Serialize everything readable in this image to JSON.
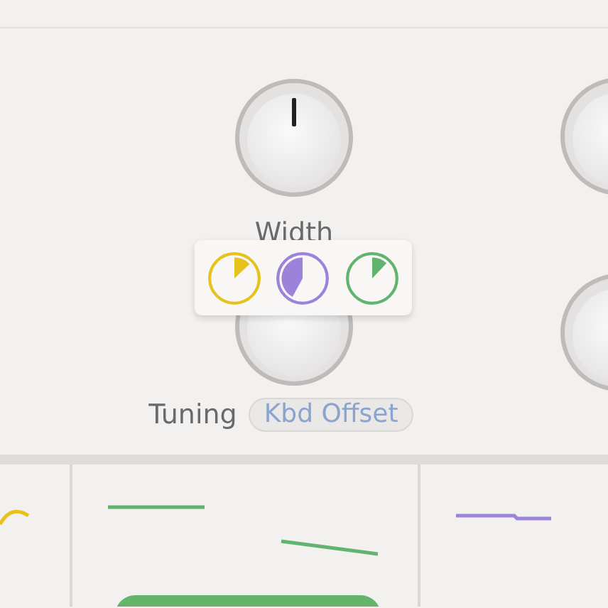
{
  "knobs": [
    {
      "label": "Width"
    },
    {
      "label": "Tuning",
      "mode": "Kbd Offset"
    }
  ],
  "mod_sources": [
    {
      "color": "#e8c21c"
    },
    {
      "color": "#9d82db"
    },
    {
      "color": "#62b36f"
    }
  ]
}
